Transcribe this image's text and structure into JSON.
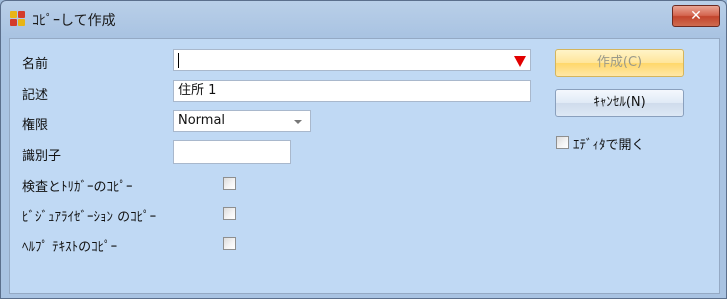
{
  "window": {
    "title": "ｺﾋﾟｰして作成",
    "close_glyph": "✕"
  },
  "form": {
    "name_label": "名前",
    "name_value": "",
    "description_label": "記述",
    "description_value": "住所 1",
    "permission_label": "権限",
    "permission_value": "Normal",
    "identifier_label": "識別子",
    "identifier_value": "",
    "copy_checks_label": "検査とﾄﾘｶﾞｰのｺﾋﾟｰ",
    "copy_checks_checked": false,
    "copy_visualization_label": "ﾋﾞｼﾞｭｱﾗｲｾﾞｰｼｮﾝ のｺﾋﾟｰ",
    "copy_visualization_checked": false,
    "copy_help_label": "ﾍﾙﾌﾟ ﾃｷｽﾄのｺﾋﾟｰ",
    "copy_help_checked": false
  },
  "buttons": {
    "create_label": "作成(C)",
    "cancel_label": "ｷｬﾝｾﾙ(N)"
  },
  "options": {
    "open_in_editor_label": "ｴﾃﾞｨﾀで開く",
    "open_in_editor_checked": false
  },
  "colors": {
    "client_bg": "#c0d9f4",
    "frame_bg": "#a9c3e2",
    "required_marker": "#e20000",
    "create_button": "#ffe59a",
    "close_button": "#c2442c"
  },
  "icons": {
    "app": "app-logo-icon",
    "close": "close-icon",
    "required": "required-arrow-icon",
    "dropdown": "chevron-down-icon"
  }
}
